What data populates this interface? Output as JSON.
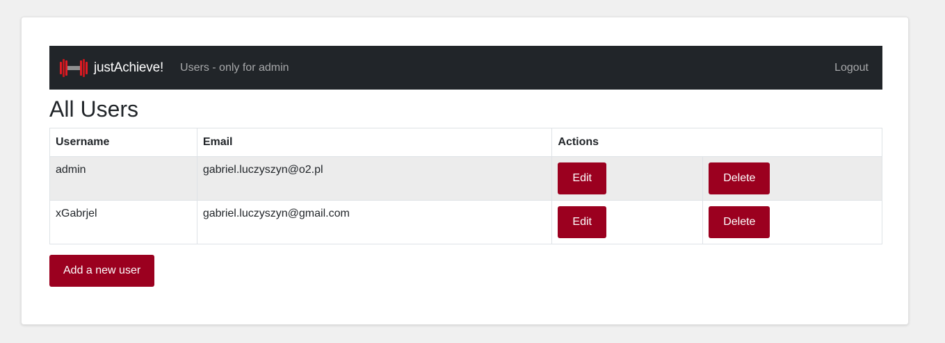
{
  "navbar": {
    "brand": "justAchieve!",
    "link": "Users - only for admin",
    "logout": "Logout",
    "logo_icon": "dumbbell-icon",
    "logo_colors": [
      "#e01b24",
      "#8f8f8f"
    ]
  },
  "page": {
    "title": "All Users"
  },
  "table": {
    "headers": [
      "Username",
      "Email",
      "Actions"
    ],
    "rows": [
      {
        "username": "admin",
        "email": "gabriel.luczyszyn@o2.pl",
        "edit": "Edit",
        "delete": "Delete"
      },
      {
        "username": "xGabrjel",
        "email": "gabriel.luczyszyn@gmail.com",
        "edit": "Edit",
        "delete": "Delete"
      }
    ]
  },
  "actions": {
    "add_user": "Add a new user"
  },
  "colors": {
    "accent": "#9b001f",
    "navbar_bg": "#212529",
    "stripe": "#ececec"
  }
}
